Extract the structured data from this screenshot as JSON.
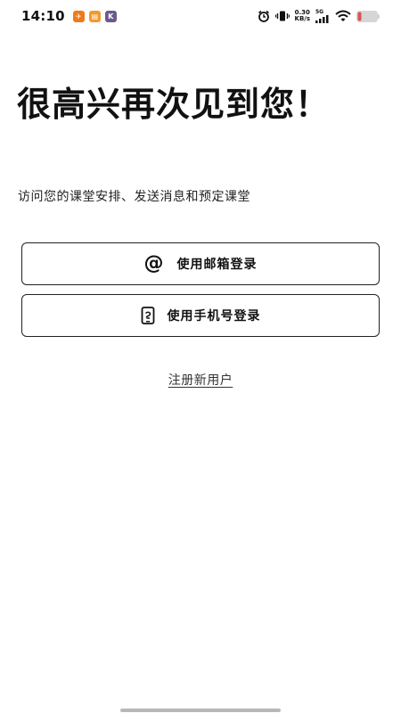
{
  "status_bar": {
    "time": "14:10",
    "app_icons": [
      {
        "name": "app-orange-icon",
        "color": "#f07a1a",
        "glyph": "✈"
      },
      {
        "name": "app-folder-icon",
        "color": "#f39a2c",
        "glyph": "▤"
      },
      {
        "name": "app-k-icon",
        "color": "#6a5a8c",
        "glyph": "K"
      }
    ],
    "net_speed_value": "0.30",
    "net_speed_unit": "KB/s",
    "network_type": "5G",
    "battery_color": "#e05050"
  },
  "heading": {
    "title": "很高兴再次见到您！",
    "subtitle": "访问您的课堂安排、发送消息和预定课堂"
  },
  "actions": {
    "email_login_label": "使用邮箱登录",
    "email_icon": "at-sign-icon",
    "phone_login_label": "使用手机号登录",
    "phone_icon": "phone-icon",
    "register_label": "注册新用户"
  }
}
